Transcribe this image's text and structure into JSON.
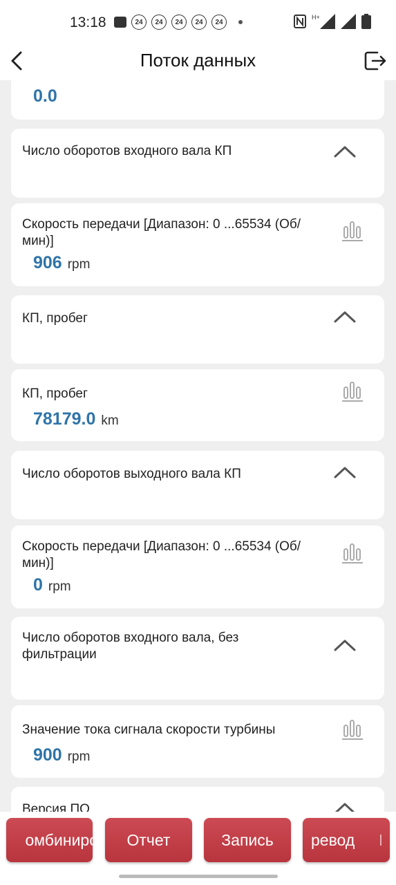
{
  "status_bar": {
    "time": "13:18",
    "notif_badges": [
      "24",
      "24",
      "24",
      "24",
      "24"
    ],
    "net_label": "H+"
  },
  "header": {
    "title": "Поток данных"
  },
  "cards": [
    {
      "value": "0.0"
    },
    {
      "label": "Число оборотов входного вала КП"
    },
    {
      "label": "Скорость передачи [Диапазон: 0 ...65534 (Об/мин)]",
      "value": "906",
      "unit": "rpm"
    },
    {
      "label": "КП, пробег"
    },
    {
      "label": "КП, пробег",
      "value": "78179.0",
      "unit": "km"
    },
    {
      "label": "Число оборотов выходного вала КП"
    },
    {
      "label": "Скорость передачи [Диапазон: 0 ...65534 (Об/мин)]",
      "value": "0",
      "unit": "rpm"
    },
    {
      "label": "Число оборотов входного вала, без фильтрации"
    },
    {
      "label": "Значение тока сигнала скорости турбины",
      "value": "900",
      "unit": "rpm"
    },
    {
      "label": "Версия ПО"
    }
  ],
  "footer": {
    "buttons": [
      "омбиниро",
      "Отчет",
      "Запись",
      "ревод"
    ]
  },
  "colors": {
    "accent": "#c0404a",
    "value_blue": "#2f74a8"
  }
}
